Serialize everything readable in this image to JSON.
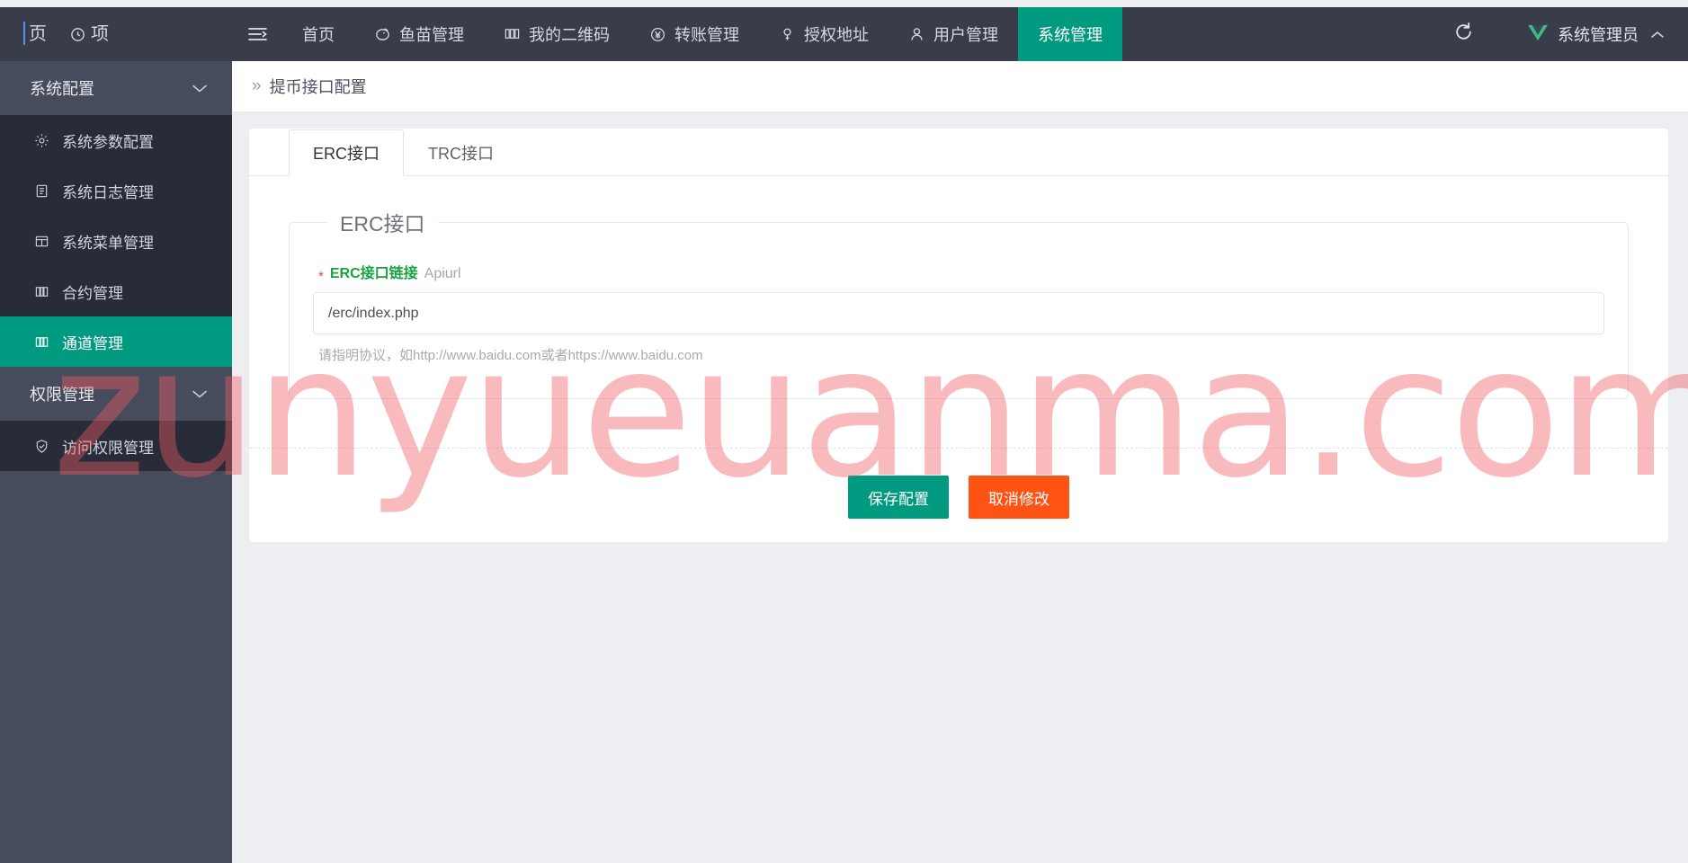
{
  "browser": {
    "tab_text_fragment": "页",
    "tab_text_fragment2": "项"
  },
  "navbar": {
    "toggle_icon": "menu-fold-icon",
    "items": [
      {
        "label": "首页",
        "icon": "none",
        "active": false
      },
      {
        "label": "鱼苗管理",
        "icon": "fish-icon",
        "active": false
      },
      {
        "label": "我的二维码",
        "icon": "qrcode-icon",
        "active": false
      },
      {
        "label": "转账管理",
        "icon": "yen-circle-icon",
        "active": false
      },
      {
        "label": "授权地址",
        "icon": "key-icon",
        "active": false
      },
      {
        "label": "用户管理",
        "icon": "user-icon",
        "active": false
      },
      {
        "label": "系统管理",
        "icon": "none",
        "active": true
      }
    ],
    "refresh_icon": "refresh-icon",
    "user_name": "系统管理员",
    "user_logo_icon": "vue-logo-icon",
    "user_chevron_icon": "chevron-up-icon",
    "active_color": "#009a80",
    "background": "#393d4a"
  },
  "sidebar": {
    "groups": [
      {
        "title": "系统配置",
        "chevron": "chevron-down-icon",
        "items": [
          {
            "label": "系统参数配置",
            "icon": "gear-icon",
            "active": false
          },
          {
            "label": "系统日志管理",
            "icon": "clipboard-icon",
            "active": false
          },
          {
            "label": "系统菜单管理",
            "icon": "window-icon",
            "active": false
          },
          {
            "label": "合约管理",
            "icon": "columns-icon",
            "active": false
          },
          {
            "label": "通道管理",
            "icon": "columns-icon",
            "active": true
          }
        ]
      },
      {
        "title": "权限管理",
        "chevron": "chevron-down-icon",
        "items": [
          {
            "label": "访问权限管理",
            "icon": "shield-check-icon",
            "active": false
          }
        ]
      }
    ],
    "active_color": "#009a80",
    "background": "#474c5c",
    "sub_background": "#272c38"
  },
  "breadcrumb": {
    "separator": "»",
    "text": "提币接口配置"
  },
  "main": {
    "tabs": [
      {
        "label": "ERC接口",
        "active": true
      },
      {
        "label": "TRC接口",
        "active": false
      }
    ],
    "fieldset": {
      "legend": "ERC接口",
      "field": {
        "required_mark": "*",
        "label": "ERC接口链接",
        "label_sub": "Apiurl",
        "value": "/erc/index.php",
        "placeholder": "",
        "help": "请指明协议，如http://www.baidu.com或者https://www.baidu.com"
      }
    },
    "buttons": {
      "save": "保存配置",
      "cancel": "取消修改",
      "save_color": "#009a80",
      "cancel_color": "#ff5215"
    }
  },
  "watermark": {
    "text": "zunyueuanma.com",
    "color": "#f05a64"
  }
}
